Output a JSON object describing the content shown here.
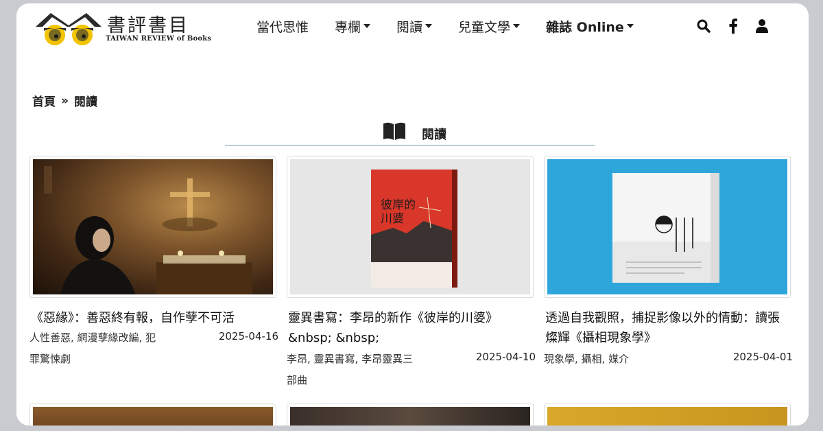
{
  "brand": {
    "title": "書評書目",
    "subtitle": "TAIWAN REVIEW of Books"
  },
  "nav": {
    "items": [
      {
        "label": "當代思惟",
        "has_dropdown": false
      },
      {
        "label": "專欄",
        "has_dropdown": true
      },
      {
        "label": "閱讀",
        "has_dropdown": true
      },
      {
        "label": "兒童文學",
        "has_dropdown": true
      },
      {
        "label": "雜誌 Online",
        "has_dropdown": true
      }
    ],
    "icons": [
      "search-icon",
      "facebook-icon",
      "user-icon"
    ]
  },
  "breadcrumb": {
    "home": "首頁",
    "separator": "»",
    "current": "閱讀"
  },
  "section": {
    "title": "閱讀",
    "icon": "open-book-icon"
  },
  "articles": [
    {
      "title": "《惡緣》：善惡終有報，自作孽不可活",
      "tags_line1": "人性善惡, 網漫孽緣改編, 犯",
      "tags_line2": "罪驚悚劇",
      "date": "2025-04-16",
      "image": "church-scene-photo"
    },
    {
      "title": "靈異書寫：李昂的新作《彼岸的川婆》&nbsp; &nbsp;",
      "tags_line1": "李昂, 靈異書寫, 李昂靈異三",
      "tags_line2": "部曲",
      "date": "2025-04-10",
      "image": "book-cover-red",
      "book_cover_text": "彼岸的川婆"
    },
    {
      "title": "透過自我觀照，捕捉影像以外的情動：讀張燦輝《攝相現象學》",
      "tags_line1": "現象學, 攝相, 媒介",
      "tags_line2": "",
      "date": "2025-04-01",
      "image": "book-cover-white-on-blue"
    }
  ],
  "colors": {
    "accent_line": "#6e9cb1",
    "logo_yellow": "#f2c300",
    "background_frame": "#c9cbd1"
  }
}
